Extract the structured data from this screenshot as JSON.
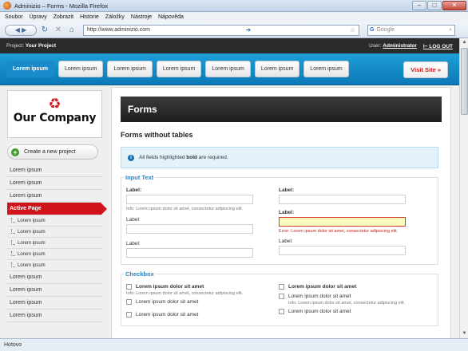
{
  "browser": {
    "title": "Adminizio – Forms - Mozilla Firefox",
    "menu": [
      "Soubor",
      "Úpravy",
      "Zobrazit",
      "Historie",
      "Záložky",
      "Nástroje",
      "Nápověda"
    ],
    "url": "http://www.adminizio.com",
    "search_placeholder": "Google",
    "status": "Hotovo"
  },
  "top": {
    "project_label": "Project:",
    "project_name": "Your Project",
    "user_label": "User:",
    "user_name": "Administrator",
    "logout": "LOG OUT"
  },
  "tabs": [
    {
      "label": "Lorem ipsum",
      "active": true
    },
    {
      "label": "Lorem ipsum",
      "active": false
    },
    {
      "label": "Lorem ipsum",
      "active": false
    },
    {
      "label": "Lorem ipsum",
      "active": false
    },
    {
      "label": "Lorem ipsum",
      "active": false
    },
    {
      "label": "Lorem ipsum",
      "active": false
    },
    {
      "label": "Lorem ipsum",
      "active": false
    }
  ],
  "visit_site": "Visit Site »",
  "sidebar": {
    "company": "Our Company",
    "new_project": "Create a new project",
    "items_top": [
      "Lorem ipsum",
      "Lorem ipsum",
      "Lorem ipsum"
    ],
    "active": "Active Page",
    "subitems": [
      "Lorem ipsum",
      "Lorem ipsum",
      "Lorem ipsum",
      "Lorem ipsum",
      "Lorem ipsum"
    ],
    "items_bottom": [
      "Lorem ipsum",
      "Lorem ipsum",
      "Lorem ipsum",
      "Lorem ipsum"
    ]
  },
  "main": {
    "header": "Forms",
    "subtitle": "Forms without tables",
    "notice_pre": "All fields highlighted",
    "notice_bold": "bold",
    "notice_post": "are required.",
    "input_text": {
      "legend": "Input Text",
      "left": [
        {
          "label": "Label:",
          "bold": true,
          "info": "Info: Lorem ipsum dolor sit amet, consectetur adipiscing elit."
        },
        {
          "label": "Label:",
          "bold": false
        },
        {
          "label": "Label:",
          "bold": false
        }
      ],
      "right": [
        {
          "label": "Label:",
          "bold": true
        },
        {
          "label": "Label:",
          "bold": true,
          "error": "Error: Lorem ipsum dolor sit amet, consectetur adipiscing elit."
        },
        {
          "label": "Label:",
          "bold": false
        }
      ]
    },
    "checkbox": {
      "legend": "Checkbox",
      "left": [
        {
          "label": "Lorem ipsum dolor sit amet",
          "bold": true,
          "info": "Info: Lorem ipsum dolor sit amet, consectetur adipiscing elit."
        },
        {
          "label": "Lorem ipsum dolor sit amet",
          "bold": false
        },
        {
          "label": "Lorem ipsum dolor sit amet",
          "bold": false
        }
      ],
      "right": [
        {
          "label": "Lorem ipsum dolor sit amet",
          "bold": true
        },
        {
          "label": "Lorem ipsum dolor sit amet",
          "bold": false,
          "info": "Info: Lorem ipsum dolor sit amet, consectetur adipiscing elit."
        },
        {
          "label": "Lorem ipsum dolor sit amet",
          "bold": false
        }
      ]
    }
  }
}
